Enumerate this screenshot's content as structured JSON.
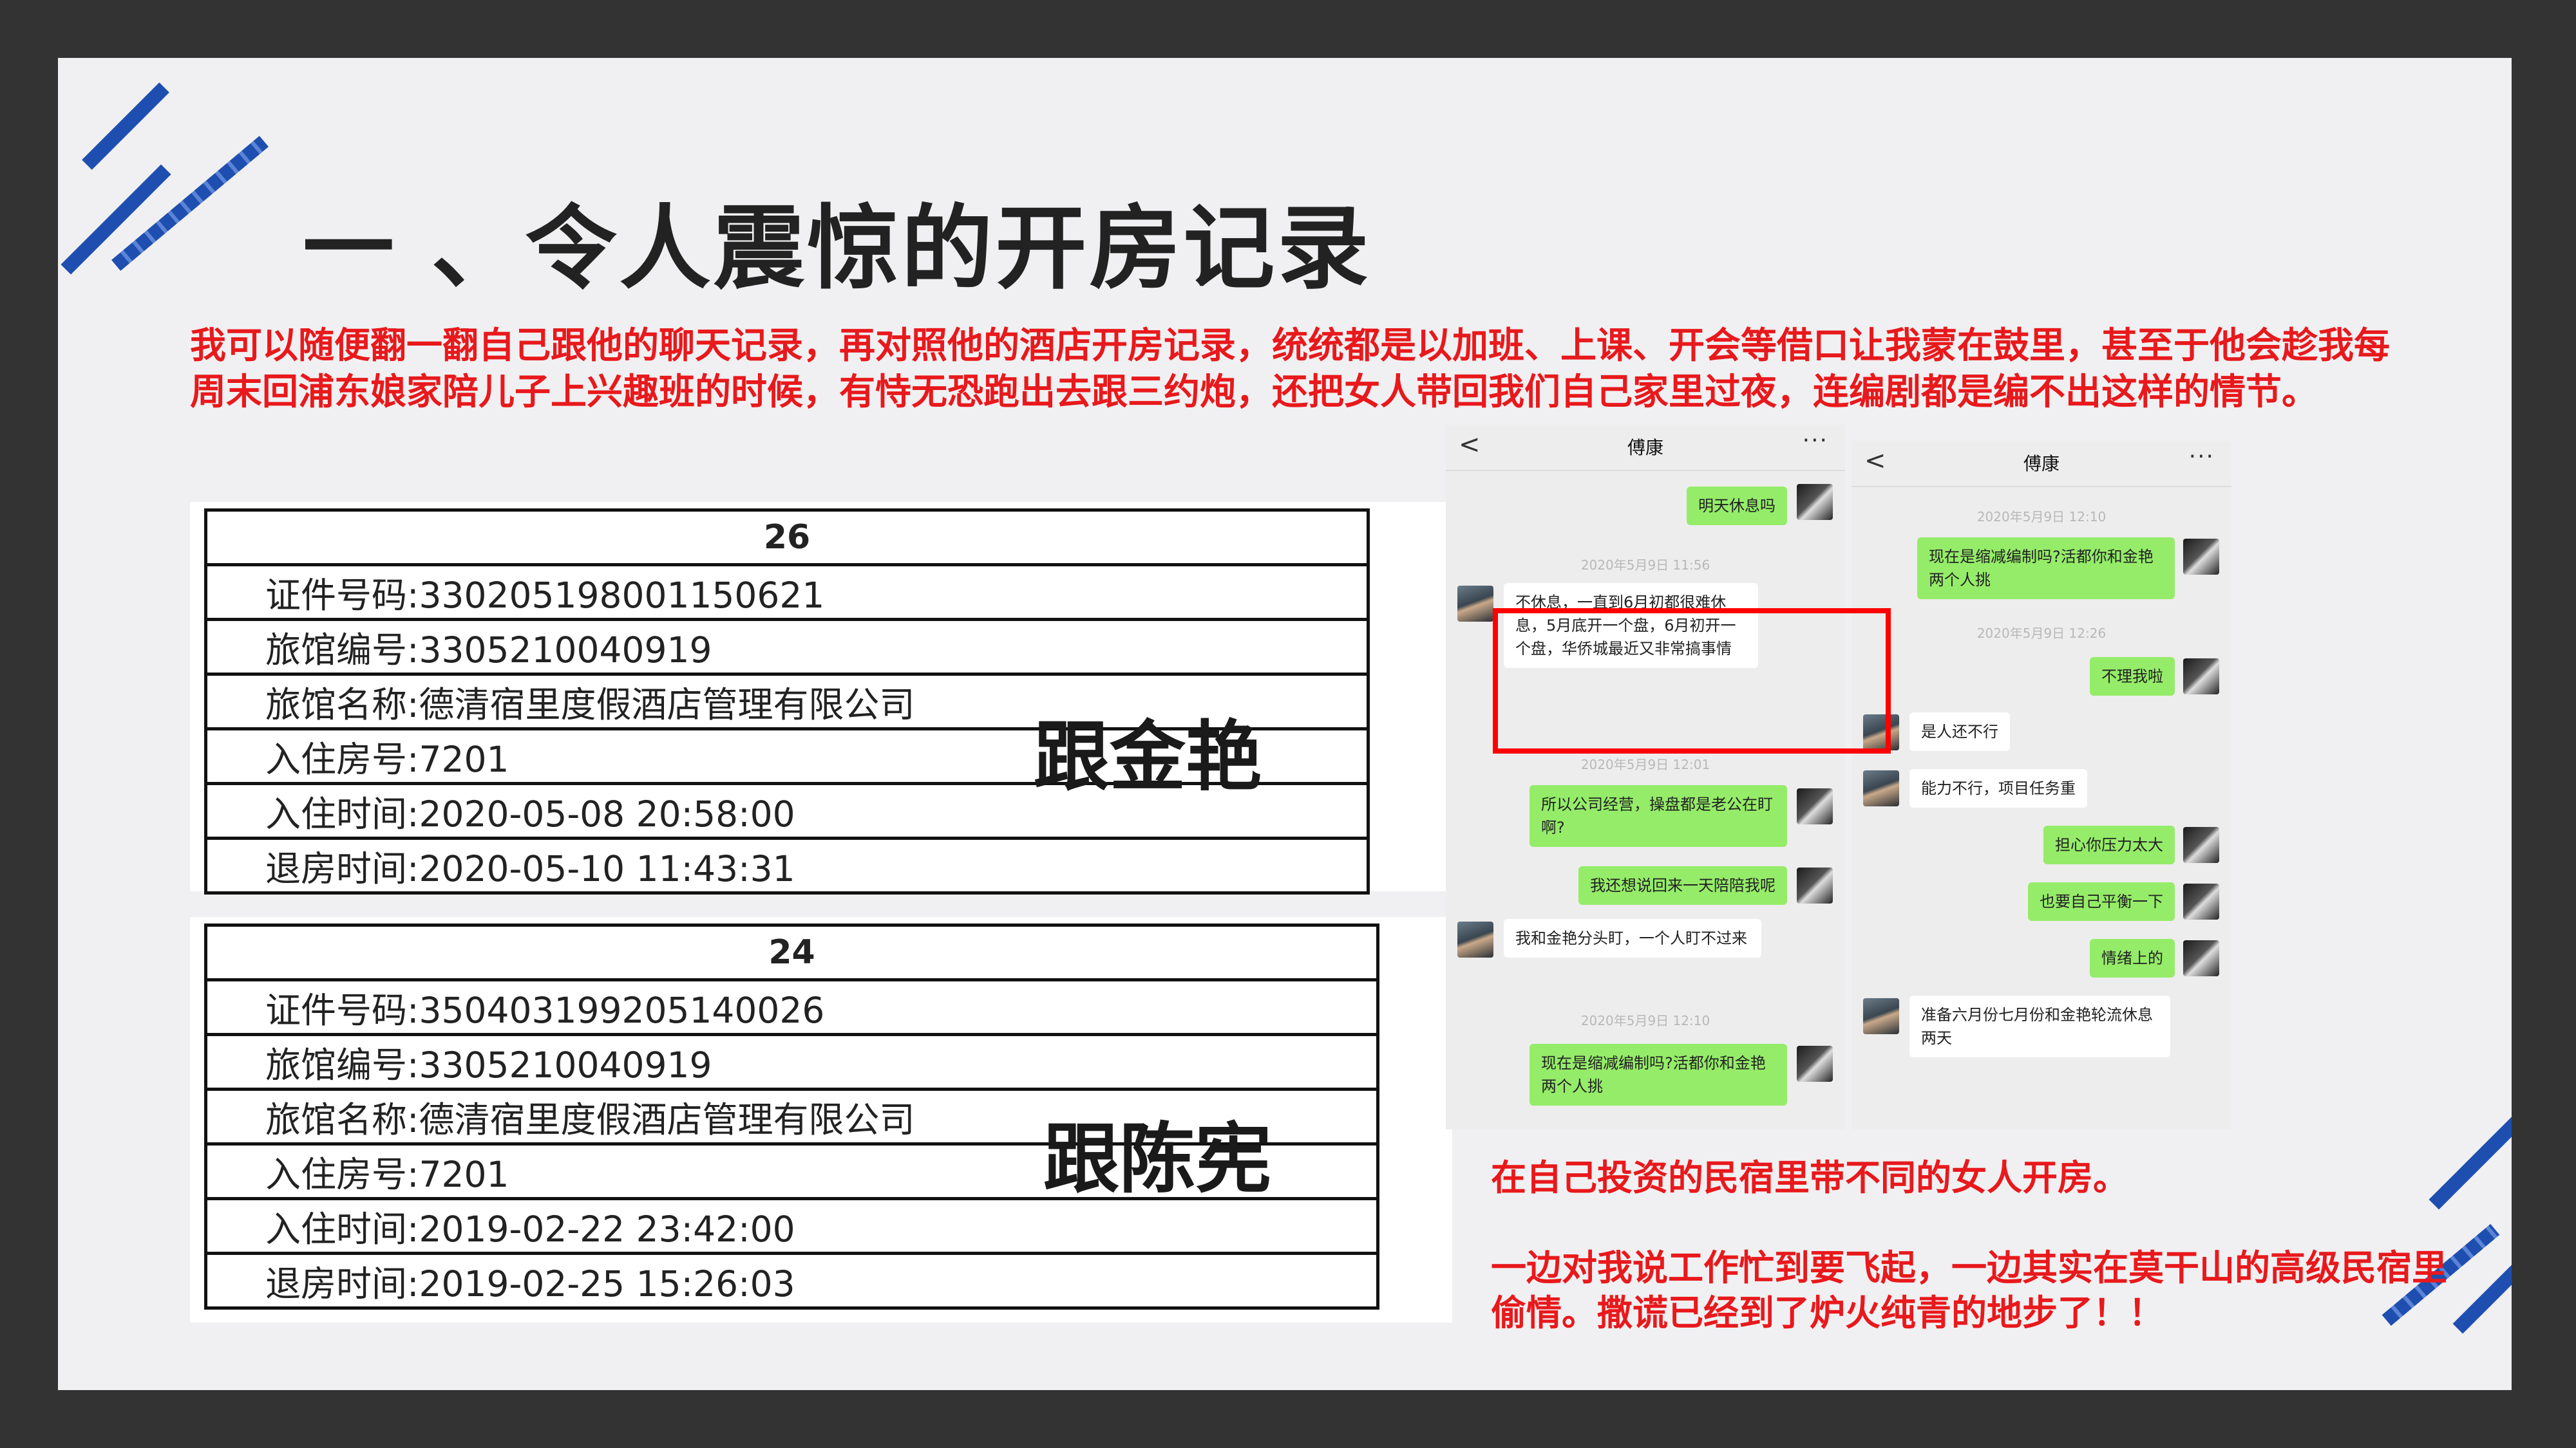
{
  "title": "一 、令人震惊的开房记录",
  "intro": "我可以随便翻一翻自己跟他的聊天记录，再对照他的酒店开房记录，统统都是以加班、上课、开会等借口让我蒙在鼓里，甚至于他会趁我每周末回浦东娘家陪儿子上兴趣班的时候，有恃无恐跑出去跟三约炮，还把女人带回我们自己家里过夜，连编剧都是编不出这样的情节。",
  "records": [
    {
      "number": "26",
      "rows": [
        "证件号码:330205198001150621",
        "旅馆编号:3305210040919",
        "旅馆名称:德清宿里度假酒店管理有限公司",
        "入住房号:7201",
        "入住时间:2020-05-08 20:58:00",
        "退房时间:2020-05-10 11:43:31"
      ],
      "label": "跟金艳"
    },
    {
      "number": "24",
      "rows": [
        "证件号码:350403199205140026",
        "旅馆编号:3305210040919",
        "旅馆名称:德清宿里度假酒店管理有限公司",
        "入住房号:7201",
        "入住时间:2019-02-22 23:42:00",
        "退房时间:2019-02-25 15:26:03"
      ],
      "label": "跟陈宪"
    }
  ],
  "chat1": {
    "back": "<",
    "name": "傅康",
    "more": "···",
    "messages": [
      {
        "side": "right",
        "text": "明天休息吗"
      },
      {
        "type": "time",
        "text": "2020年5月9日 11:56"
      },
      {
        "side": "left",
        "text": "不休息，一直到6月初都很难休息，5月底开一个盘，6月初开一个盘，华侨城最近又非常搞事情"
      },
      {
        "type": "time",
        "text": "2020年5月9日 12:01"
      },
      {
        "side": "right",
        "text": "所以公司经营，操盘都是老公在盯啊?"
      },
      {
        "side": "right",
        "text": "我还想说回来一天陪陪我呢"
      },
      {
        "side": "left",
        "text": "我和金艳分头盯，一个人盯不过来"
      },
      {
        "type": "time",
        "text": "2020年5月9日 12:10"
      },
      {
        "side": "right",
        "text": "现在是缩减编制吗?活都你和金艳两个人挑"
      }
    ]
  },
  "chat2": {
    "back": "<",
    "name": "傅康",
    "more": "···",
    "messages": [
      {
        "type": "time",
        "text": "2020年5月9日 12:10"
      },
      {
        "side": "right",
        "text": "现在是缩减编制吗?活都你和金艳两个人挑"
      },
      {
        "type": "time",
        "text": "2020年5月9日 12:26"
      },
      {
        "side": "right",
        "text": "不理我啦"
      },
      {
        "side": "left",
        "text": "是人还不行"
      },
      {
        "side": "left",
        "text": "能力不行，项目任务重"
      },
      {
        "side": "right",
        "text": "担心你压力太大"
      },
      {
        "side": "right",
        "text": "也要自己平衡一下"
      },
      {
        "side": "right",
        "text": "情绪上的"
      },
      {
        "side": "left",
        "text": "准备六月份七月份和金艳轮流休息两天"
      }
    ]
  },
  "notes": [
    "在自己投资的民宿里带不同的女人开房。",
    "一边对我说工作忙到要飞起，一边其实在莫干山的高级民宿里偷情。撒谎已经到了炉火纯青的地步了！！"
  ],
  "colors": {
    "accent_red": "#e8191c",
    "stripe_blue": "#1e4fb0",
    "wechat_green": "#95ec69",
    "frame": "#333333"
  }
}
